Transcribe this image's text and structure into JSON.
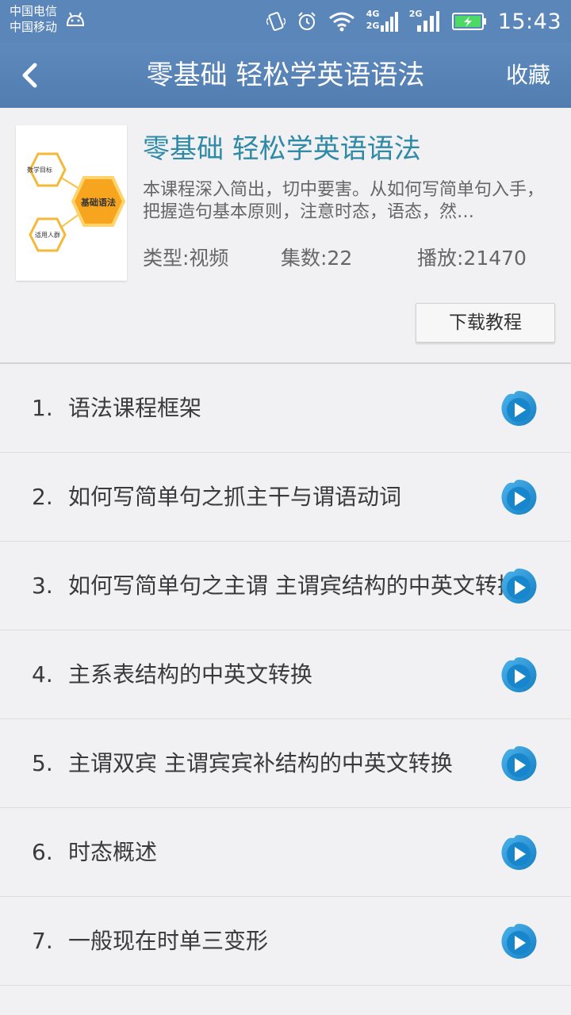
{
  "status_bar": {
    "carrier_1": "中国电信",
    "carrier_2": "中国移动",
    "net_4g": "4G",
    "net_2g_a": "2G",
    "net_2g_b": "2G",
    "time": "15:43",
    "icons": [
      "android-icon",
      "vibrate-icon",
      "alarm-icon",
      "wifi-icon",
      "signal-icon",
      "battery-charging-icon"
    ]
  },
  "header": {
    "title": "零基础 轻松学英语语法",
    "favorite_label": "收藏",
    "back_icon": "chevron-left-icon"
  },
  "course": {
    "title": "零基础 轻松学英语语法",
    "description": "本课程深入简出，切中要害。从如何写简单句入手，把握造句基本原则，注意时态，语态，然…",
    "type": "类型:视频",
    "episodes": "集数:22",
    "plays": "播放:21470",
    "download_label": "下载教程",
    "cover": {
      "center_label": "基础语法",
      "node_top": "数学目标",
      "node_bottom": "适用人群"
    }
  },
  "lessons": [
    {
      "num": "1.",
      "title": "语法课程框架"
    },
    {
      "num": "2.",
      "title": "如何写简单句之抓主干与谓语动词"
    },
    {
      "num": "3.",
      "title": "如何写简单句之主谓 主谓宾结构的中英文转换"
    },
    {
      "num": "4.",
      "title": "主系表结构的中英文转换"
    },
    {
      "num": "5.",
      "title": "主谓双宾 主谓宾宾补结构的中英文转换"
    },
    {
      "num": "6.",
      "title": "时态概述"
    },
    {
      "num": "7.",
      "title": "一般现在时单三变形"
    }
  ],
  "colors": {
    "header_bg": "#5b86b9",
    "title_accent": "#2f8aa8",
    "play_blue": "#1e8fd0",
    "hex_orange": "#f5a623"
  }
}
